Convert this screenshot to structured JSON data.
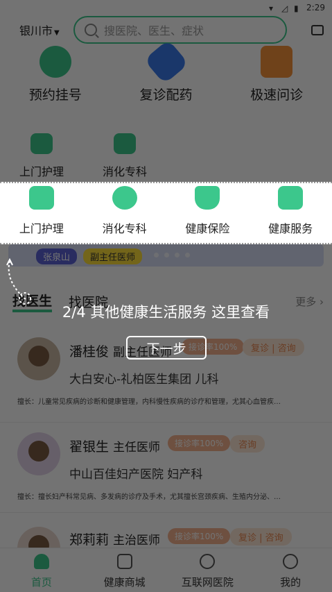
{
  "status_bar": {
    "time": "2:29"
  },
  "header": {
    "city": "银川市",
    "search_placeholder": "搜医院、医生、症状"
  },
  "main_services": [
    {
      "label": "预约挂号",
      "icon": "plus-cross-icon",
      "color": "#3cc78c"
    },
    {
      "label": "复诊配药",
      "icon": "pill-icon",
      "color": "#3b7bea"
    },
    {
      "label": "极速问诊",
      "icon": "chat-icon",
      "color": "#f5923a"
    }
  ],
  "services_dim": [
    {
      "label": "上门护理",
      "icon": "nurse-icon"
    },
    {
      "label": "消化专科",
      "icon": "stomach-icon"
    }
  ],
  "highlight_services": [
    {
      "label": "上门护理",
      "icon": "nurse-icon"
    },
    {
      "label": "消化专科",
      "icon": "stomach-icon"
    },
    {
      "label": "健康保险",
      "icon": "shield-star-icon"
    },
    {
      "label": "健康服务",
      "icon": "medical-kit-icon"
    }
  ],
  "banner": {
    "name": "张泉山",
    "title": "副主任医师"
  },
  "tabs": {
    "find_doctor": "找医生",
    "find_hospital": "找医院",
    "more": "更多"
  },
  "doctors": [
    {
      "name": "潘桂俊",
      "title": "副主任医师",
      "badge": "接诊率100%",
      "actions": "复诊 | 咨询",
      "hospital": "大白安心-礼柏医生集团 儿科",
      "desc": "擅长：儿童常见疾病的诊断和健康管理，内科慢性疾病的诊疗和管理，尤其心血管疾…"
    },
    {
      "name": "翟银生",
      "title": "主任医师",
      "badge": "接诊率100%",
      "actions": "咨询",
      "hospital": "中山百佳妇产医院 妇产科",
      "desc": "擅长：擅长妇产科常见病、多发病的诊疗及手术，尤其擅长宫颈疾病、生殖内分泌、…"
    },
    {
      "name": "郑莉莉",
      "title": "主治医师",
      "badge": "接诊率100%",
      "actions": "复诊 | 咨询"
    }
  ],
  "bottom_nav": [
    {
      "label": "首页",
      "icon": "home-icon"
    },
    {
      "label": "健康商城",
      "icon": "shopping-bag-icon"
    },
    {
      "label": "互联网医院",
      "icon": "cloud-plus-icon"
    },
    {
      "label": "我的",
      "icon": "user-icon"
    }
  ],
  "guide": {
    "text": "2/4 其他健康生活服务 这里查看",
    "next": "下一步"
  }
}
